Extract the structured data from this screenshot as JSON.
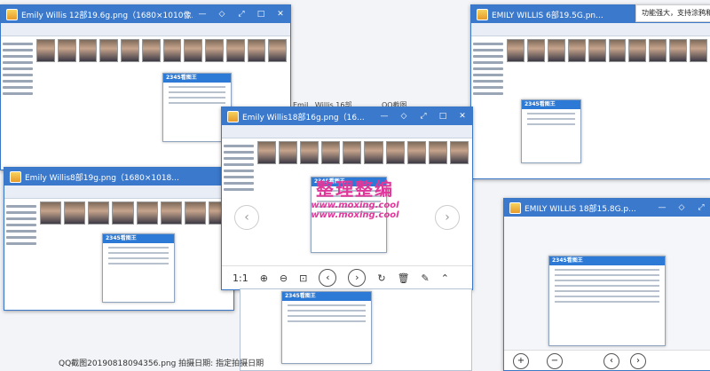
{
  "windows": [
    {
      "title": "Emily Willis 12部19.6g.png（1680×1010像..."
    },
    {
      "title": "EMILY WILLIS 6部19.5G.pn..."
    },
    {
      "title": "Emily Willis8部19g.png（1680×1018..."
    },
    {
      "title": "Emily Willis18部16g.png（16..."
    },
    {
      "title": "EMILY WILLIS 18部15.8G.p..."
    }
  ],
  "viewer": {
    "toolbar": {
      "ratio_label": "1:1"
    }
  },
  "watermark": {
    "title": "整理整编",
    "url1": "www.moxing.cool",
    "url2": "www.moxing.cool"
  },
  "dialog": {
    "brand": "2345看图王"
  },
  "bottom_caption": "QQ截图20190818094356.png  拍摄日期: 指定拍摄日期",
  "top_right_label": "功能强大，支持涂鸦和马赛克",
  "background_text": {
    "mid_label": "Emil...Willis 16部",
    "qq_label": "QQ截图"
  }
}
